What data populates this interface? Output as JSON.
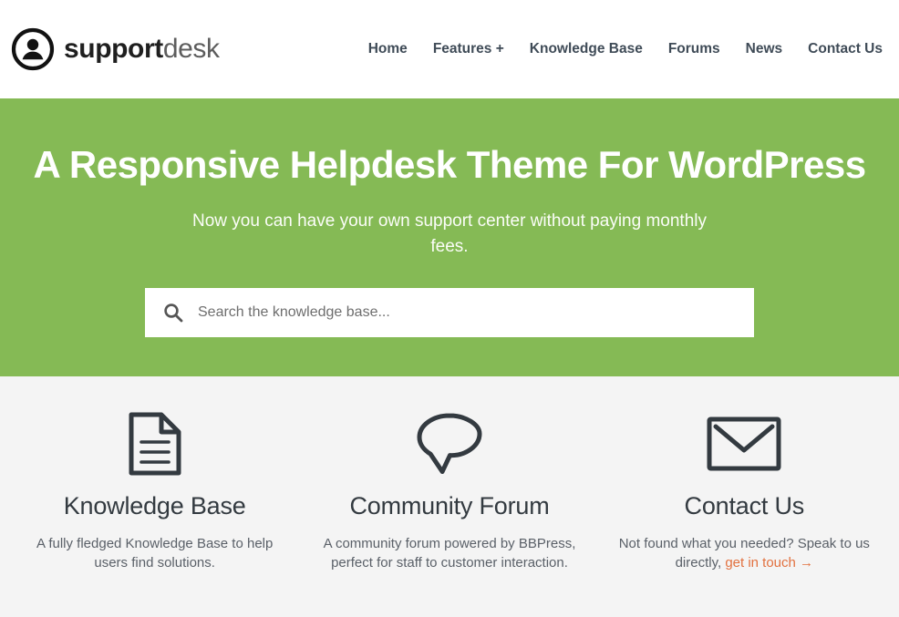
{
  "colors": {
    "hero_green": "#85ba55",
    "accent_orange": "#e2713f",
    "features_bg": "#f4f4f4",
    "nav_text": "#3f4b57",
    "heading_dark": "#333a40"
  },
  "header": {
    "logo_icon": "user-circle-icon",
    "logo_strong": "support",
    "logo_light": "desk",
    "nav": [
      {
        "label": "Home",
        "name": "nav-home"
      },
      {
        "label": "Features +",
        "name": "nav-features"
      },
      {
        "label": "Knowledge Base",
        "name": "nav-knowledge-base"
      },
      {
        "label": "Forums",
        "name": "nav-forums"
      },
      {
        "label": "News",
        "name": "nav-news"
      },
      {
        "label": "Contact Us",
        "name": "nav-contact-us"
      }
    ]
  },
  "hero": {
    "title": "A Responsive Helpdesk Theme For WordPress",
    "subtitle": "Now you can have your own support center without paying monthly fees.",
    "search": {
      "icon": "search-icon",
      "placeholder": "Search the knowledge base...",
      "value": ""
    }
  },
  "features": [
    {
      "icon": "document-icon",
      "title": "Knowledge Base",
      "desc": "A fully fledged Knowledge Base to help users find solutions."
    },
    {
      "icon": "speech-bubble-icon",
      "title": "Community Forum",
      "desc": "A community forum powered by BBPress, perfect for staff to customer interaction."
    },
    {
      "icon": "envelope-icon",
      "title": "Contact Us",
      "desc_before": "Not found what you needed? Speak to us directly, ",
      "link_label": "get in touch →",
      "title_alt": "Contact Us"
    }
  ]
}
